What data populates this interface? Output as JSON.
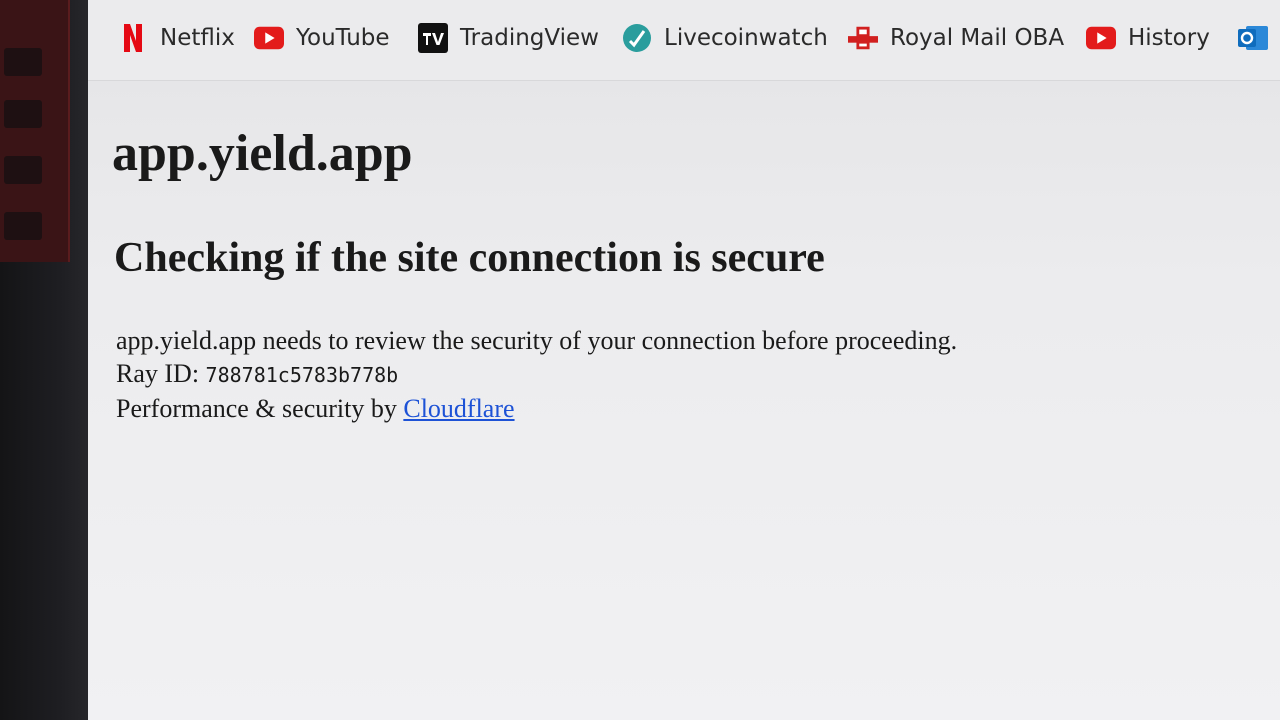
{
  "bookmarks": [
    {
      "label": "Netflix",
      "icon": "netflix-icon"
    },
    {
      "label": "YouTube",
      "icon": "youtube-icon"
    },
    {
      "label": "TradingView",
      "icon": "tradingview-icon"
    },
    {
      "label": "Livecoinwatch",
      "icon": "livecoinwatch-icon"
    },
    {
      "label": "Royal Mail OBA",
      "icon": "royal-mail-icon"
    },
    {
      "label": "History",
      "icon": "youtube-icon"
    },
    {
      "label": "",
      "icon": "outlook-icon"
    }
  ],
  "page": {
    "site_title": "app.yield.app",
    "heading": "Checking if the site connection is secure",
    "review_text": "app.yield.app needs to review the security of your connection before proceeding.",
    "ray_label": "Ray ID: ",
    "ray_id": "788781c5783b778b",
    "performance_text": "Performance & security by ",
    "cloudflare_link": "Cloudflare"
  },
  "colors": {
    "netflix_red": "#e50914",
    "youtube_red": "#e31b1b",
    "link_blue": "#1d52d6",
    "outlook_blue": "#0f6cbd"
  }
}
